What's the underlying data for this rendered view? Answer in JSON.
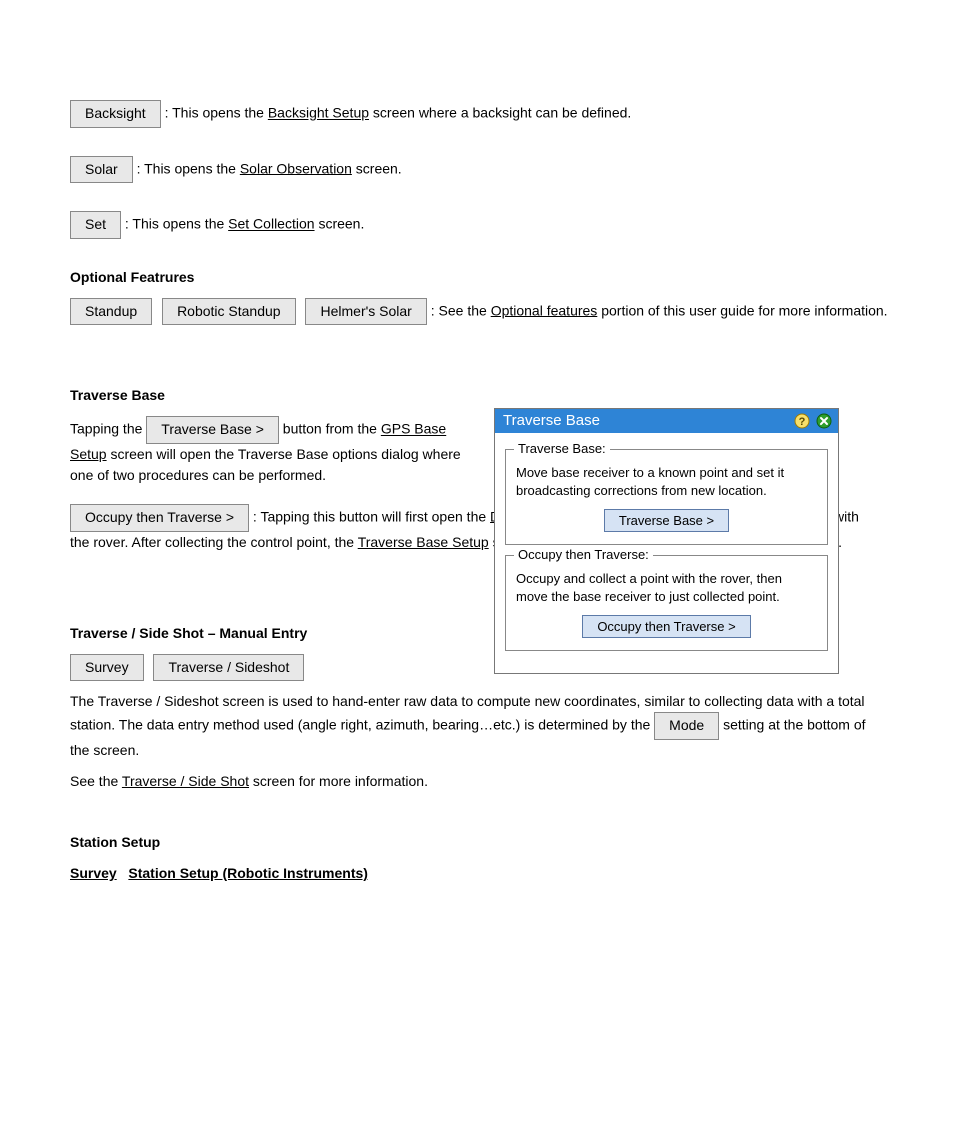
{
  "items": [
    {
      "btn": "Backsight",
      "after": ": This opens the ",
      "link": "Backsight Setup",
      "tail": " screen where a backsight can be defined."
    },
    {
      "btn": "Solar",
      "after": ": This opens the ",
      "link": "Solar Observation",
      "tail": " screen."
    },
    {
      "btn": "Set",
      "after": ": This opens the ",
      "link": "Set Collection",
      "tail": " screen."
    }
  ],
  "optional": {
    "heading": "Optional Featrures",
    "btnRow": {
      "b1": "Standup",
      "b2": "Robotic Standup",
      "b3": "Helmer's Solar"
    },
    "afterRow": ": See the ",
    "rowLink": "Optional features",
    "rowTail": " portion of this user guide for more information."
  },
  "traverse": {
    "heading": "Traverse Base",
    "line1a": "Tapping the ",
    "btn1": "Traverse Base >",
    "line1b": " button from the ",
    "line1link": "GPS Base Setup",
    "line1c": " screen will open the Traverse Base options dialog where one of two procedures can be performed.",
    "btn2": "Occupy then Traverse >",
    "line2a": ": Tapping this button will first open the ",
    "line2link": "Data Collection",
    "line2b": " screen so a control point can be stored with the rover. After collecting the control point, the ",
    "line2link2": "Traverse Base Setup",
    "line2c": " screen will open where the new base location is defined."
  },
  "station": {
    "heading": "Traverse / Side Shot – Manual Entry",
    "nav": "Survey",
    "nav2": "Traverse / Sideshot",
    "text1": "The Traverse / Sideshot screen is used to hand-enter raw data to compute new coordinates, similar to collecting data with a total station. The data entry method used (angle right, azimuth, bearing…etc.) is determined by the ",
    "btn1": "Mode",
    "text2": " setting at the bottom of the screen.",
    "text3": "See the ",
    "link1": "Traverse / Side Shot",
    "text4": " screen for more information.",
    "heading2": "Station Setup",
    "nav3": "Survey",
    "nav4": "Station Setup (Robotic Instruments)"
  },
  "dialog": {
    "title": "Traverse Base",
    "g1": {
      "legend": "Traverse Base:",
      "desc": "Move base receiver to a known point and set it broadcasting corrections from new location.",
      "btn": "Traverse Base >"
    },
    "g2": {
      "legend": "Occupy then Traverse:",
      "desc": "Occupy and collect a point with the rover, then move the base receiver to just collected point.",
      "btn": "Occupy then Traverse >"
    }
  }
}
